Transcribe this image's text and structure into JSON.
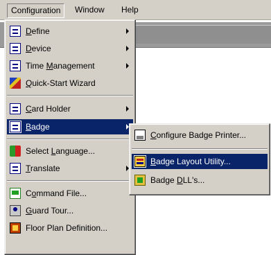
{
  "menubar": {
    "items": [
      {
        "label": "Configuration"
      },
      {
        "label": "Window"
      },
      {
        "label": "Help"
      }
    ]
  },
  "config_menu": {
    "items": [
      {
        "label_pre": "",
        "label_acc": "D",
        "label_post": "efine",
        "icon": "list-icon",
        "has_submenu": true
      },
      {
        "label_pre": "",
        "label_acc": "D",
        "label_post": "evice",
        "icon": "list-icon",
        "has_submenu": true
      },
      {
        "label_pre": "Time ",
        "label_acc": "M",
        "label_post": "anagement",
        "icon": "list-icon",
        "has_submenu": true
      },
      {
        "label_pre": "",
        "label_acc": "Q",
        "label_post": "uick-Start Wizard",
        "icon": "wizard-wand-icon",
        "has_submenu": false
      },
      {
        "label_pre": "",
        "label_acc": "C",
        "label_post": "ard Holder",
        "icon": "list-icon",
        "has_submenu": true
      },
      {
        "label_pre": "",
        "label_acc": "B",
        "label_post": "adge",
        "icon": "list-icon",
        "has_submenu": true,
        "selected": true
      },
      {
        "label_pre": "Select ",
        "label_acc": "L",
        "label_post": "anguage...",
        "icon": "language-flag-icon",
        "has_submenu": false
      },
      {
        "label_pre": "",
        "label_acc": "T",
        "label_post": "ranslate",
        "icon": "list-icon",
        "has_submenu": true
      },
      {
        "label_pre": "C",
        "label_acc": "o",
        "label_post": "mmand File...",
        "icon": "command-file-icon",
        "has_submenu": false
      },
      {
        "label_pre": "",
        "label_acc": "G",
        "label_post": "uard Tour...",
        "icon": "guard-tour-icon",
        "has_submenu": false
      },
      {
        "label_pre": "Floor Plan Definition...",
        "label_acc": "",
        "label_post": "",
        "icon": "floor-plan-icon",
        "has_submenu": false
      }
    ]
  },
  "badge_submenu": {
    "items": [
      {
        "label_pre": "",
        "label_acc": "C",
        "label_post": "onfigure Badge Printer...",
        "icon": "badge-printer-icon"
      },
      {
        "label_pre": "",
        "label_acc": "B",
        "label_post": "adge Layout Utility...",
        "icon": "badge-layout-icon",
        "selected": true
      },
      {
        "label_pre": "Badge ",
        "label_acc": "D",
        "label_post": "LL's...",
        "icon": "badge-dll-icon"
      }
    ]
  },
  "colors": {
    "menu_face": "#d4d0c8",
    "highlight": "#0a246a",
    "highlight_text": "#ffffff"
  }
}
